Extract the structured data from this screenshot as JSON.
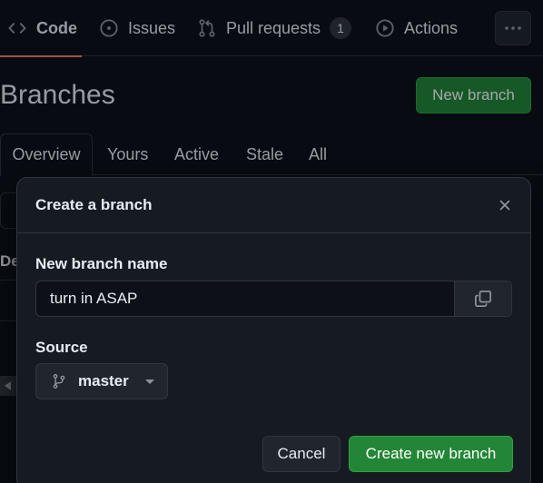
{
  "repo_nav": {
    "items": [
      {
        "label": "Code",
        "icon": "code-icon",
        "selected": true
      },
      {
        "label": "Issues",
        "icon": "issue-opened-icon"
      },
      {
        "label": "Pull requests",
        "icon": "git-pull-request-icon",
        "count": "1"
      },
      {
        "label": "Actions",
        "icon": "play-icon"
      }
    ],
    "more_icon": "kebab-horizontal-icon"
  },
  "page": {
    "title": "Branches",
    "new_branch_label": "New branch"
  },
  "tabs": [
    {
      "label": "Overview",
      "active": true
    },
    {
      "label": "Yours"
    },
    {
      "label": "Active"
    },
    {
      "label": "Stale"
    },
    {
      "label": "All"
    }
  ],
  "background_peek": {
    "text": "De"
  },
  "dialog": {
    "title": "Create a branch",
    "close_icon": "x-icon",
    "name_label": "New branch name",
    "name_value": "turn in ASAP",
    "copy_icon": "copy-icon",
    "source_label": "Source",
    "source_value": "master",
    "source_icon": "git-branch-icon",
    "cancel_label": "Cancel",
    "create_label": "Create new branch"
  },
  "colors": {
    "background": "#0d1117",
    "surface": "#161b22",
    "border": "#30363d",
    "primary_button": "#238636",
    "nav_underline": "#f78166"
  }
}
